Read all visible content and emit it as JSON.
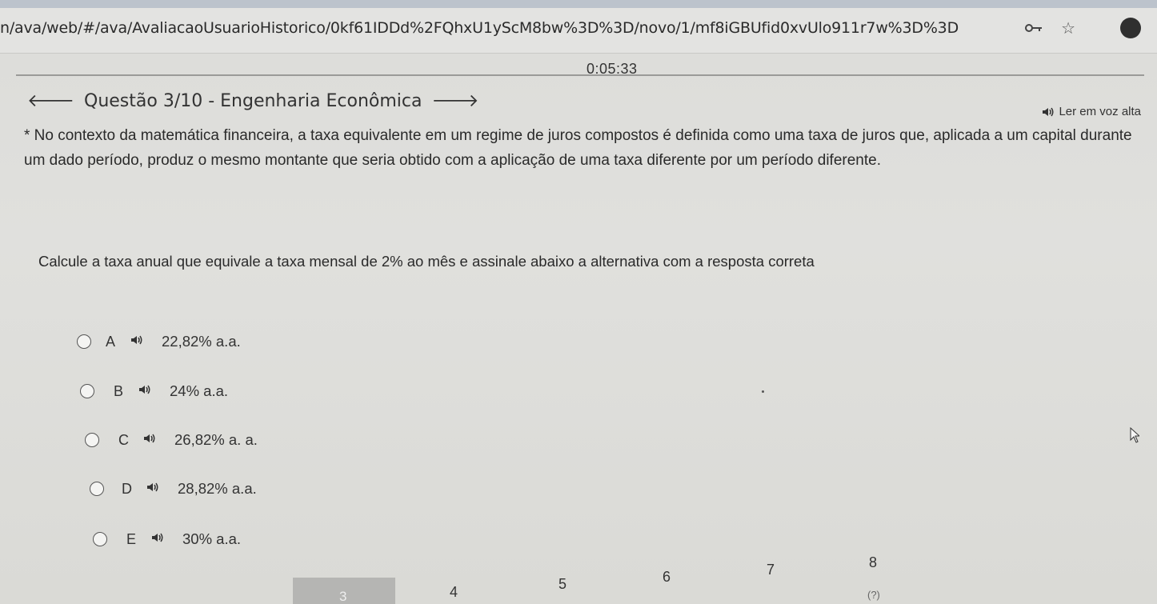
{
  "browser": {
    "url": "n/ava/web/#/ava/AvaliacaoUsuarioHistorico/0kf61IDDd%2FQhxU1yScM8bw%3D%3D/novo/1/mf8iGBUfid0xvUlo911r7w%3D%3D",
    "icons": [
      "key-icon",
      "star-icon",
      "profile-icon"
    ]
  },
  "timer": "0:05:33",
  "question": {
    "title": "Questão 3/10 - Engenharia Econômica",
    "read_aloud": "Ler em voz alta",
    "statement": "* No contexto da matemática financeira, a taxa equivalente em um regime de juros compostos é definida como uma taxa de juros que, aplicada a um capital durante um dado período, produz o mesmo montante que seria obtido com a aplicação de uma taxa diferente por um período diferente.",
    "prompt": "Calcule a taxa anual que equivale a taxa mensal de 2% ao mês e assinale abaixo a alternativa com a resposta correta"
  },
  "options": [
    {
      "letter": "A",
      "text": "22,82% a.a."
    },
    {
      "letter": "B",
      "text": "24% a.a."
    },
    {
      "letter": "C",
      "text": "26,82% a. a."
    },
    {
      "letter": "D",
      "text": "28,82% a.a."
    },
    {
      "letter": "E",
      "text": "30% a.a."
    }
  ],
  "pagination": {
    "current": "3",
    "pages": [
      "4",
      "5",
      "6",
      "7",
      "8"
    ],
    "sub_label": "(?)"
  }
}
